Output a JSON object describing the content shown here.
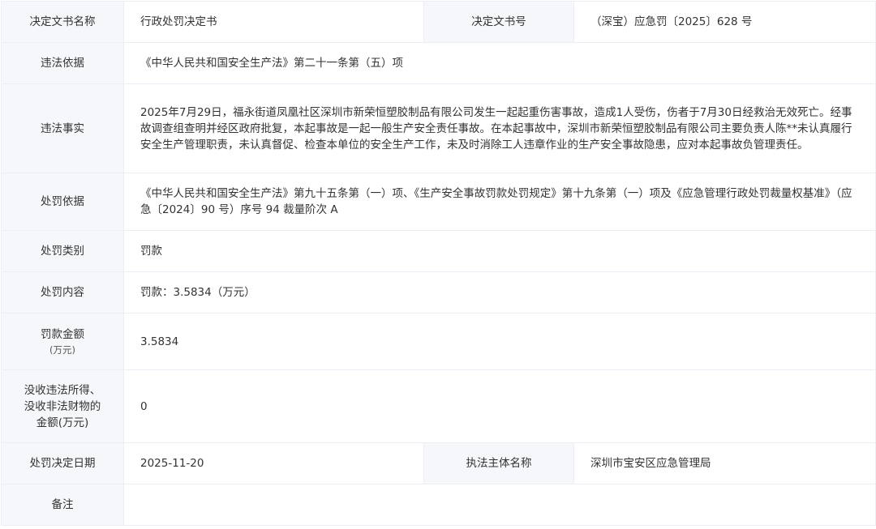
{
  "rows": {
    "doc_name": {
      "label": "决定文书名称",
      "value": "行政处罚决定书",
      "label2": "决定文书号",
      "value2": "（深宝）应急罚〔2025〕628 号"
    },
    "basis": {
      "label": "违法依据",
      "value": "《中华人民共和国安全生产法》第二十一条第（五）项"
    },
    "facts": {
      "label": "违法事实",
      "value": "2025年7月29日，福永街道凤凰社区深圳市新荣恒塑胶制品有限公司发生一起起重伤害事故，造成1人受伤，伤者于7月30日经救治无效死亡。经事故调查组查明并经区政府批复，本起事故是一起一般生产安全责任事故。在本起事故中，深圳市新荣恒塑胶制品有限公司主要负责人陈**未认真履行安全生产管理职责，未认真督促、检查本单位的安全生产工作，未及时消除工人违章作业的生产安全事故隐患，应对本起事故负管理责任。"
    },
    "penalty_basis": {
      "label": "处罚依据",
      "value": "《中华人民共和国安全生产法》第九十五条第（一）项、《生产安全事故罚款处罚规定》第十九条第（一）项及《应急管理行政处罚裁量权基准》（应急〔2024〕90 号）序号 94 裁量阶次 A"
    },
    "penalty_type": {
      "label": "处罚类别",
      "value": "罚款"
    },
    "penalty_content": {
      "label": "处罚内容",
      "value": "罚款：3.5834（万元）"
    },
    "fine_amount": {
      "label": "罚款金额",
      "label_unit": "(万元)",
      "value": "3.5834"
    },
    "confiscation": {
      "label_line1": "没收违法所得、",
      "label_line2": "没收非法财物的",
      "label_line3": "金额(万元)",
      "value": "0"
    },
    "decision_date": {
      "label": "处罚决定日期",
      "value": "2025-11-20",
      "label2": "执法主体名称",
      "value2": "深圳市宝安区应急管理局"
    },
    "remarks": {
      "label": "备注",
      "value": ""
    }
  }
}
